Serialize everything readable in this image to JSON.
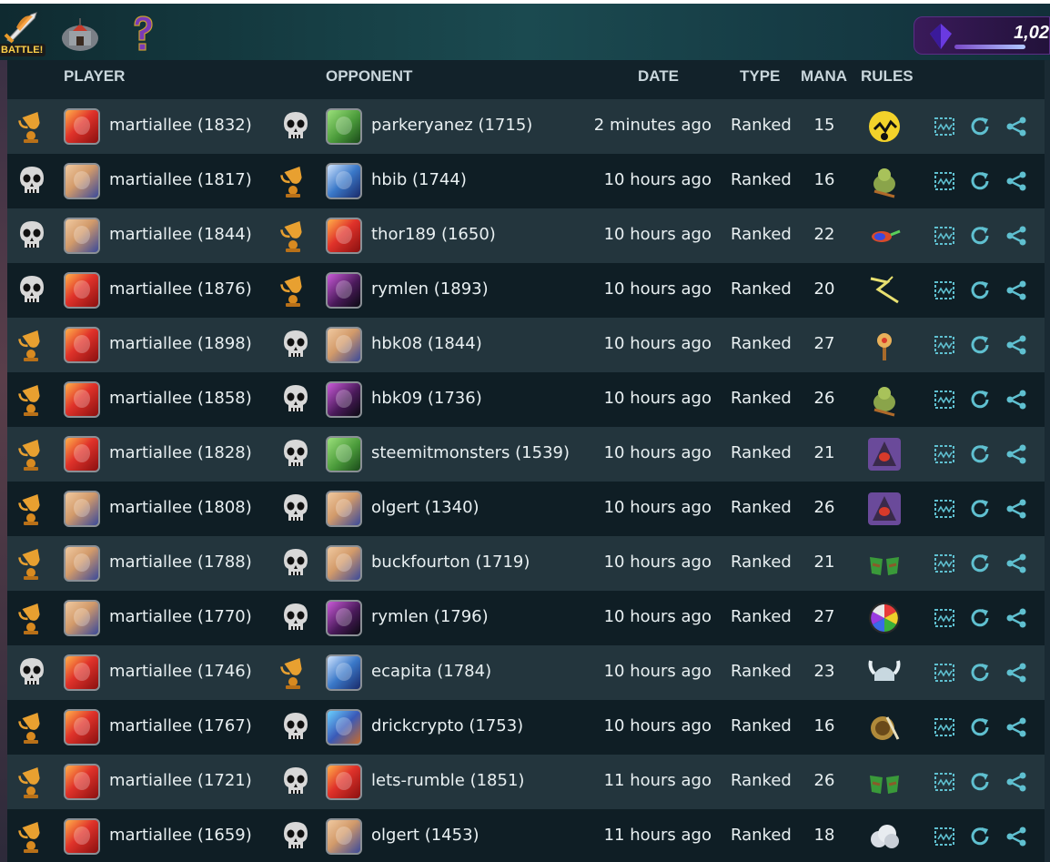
{
  "nav": {
    "battle_label": "BATTLE!",
    "dec_value": "1,02"
  },
  "headers": {
    "player": "PLAYER",
    "opponent": "OPPONENT",
    "date": "DATE",
    "type": "TYPE",
    "mana": "MANA",
    "rules": "RULES"
  },
  "colors": {
    "trophy": "#e8a030",
    "skull": "#d8d8d8",
    "action": "#5fc0d0"
  },
  "battles": [
    {
      "player_result": "win",
      "player_avatar": "fire",
      "player": "martiallee (1832)",
      "opp_result": "loss",
      "opp_avatar": "green",
      "opponent": "parkeryanez (1715)",
      "date": "2 minutes ago",
      "type": "Ranked",
      "mana": "15",
      "rule_icon": "earthquake-yellow-icon"
    },
    {
      "player_result": "loss",
      "player_avatar": "hero",
      "player": "martiallee (1817)",
      "opp_result": "win",
      "opp_avatar": "wizard",
      "opponent": "hbib (1744)",
      "date": "10 hours ago",
      "type": "Ranked",
      "mana": "16",
      "rule_icon": "goblin-icon"
    },
    {
      "player_result": "loss",
      "player_avatar": "hero",
      "player": "martiallee (1844)",
      "opp_result": "win",
      "opp_avatar": "fire",
      "opponent": "thor189 (1650)",
      "date": "10 hours ago",
      "type": "Ranked",
      "mana": "22",
      "rule_icon": "comet-icon"
    },
    {
      "player_result": "loss",
      "player_avatar": "fire",
      "player": "martiallee (1876)",
      "opp_result": "win",
      "opp_avatar": "dark",
      "opponent": "rymlen (1893)",
      "date": "10 hours ago",
      "type": "Ranked",
      "mana": "20",
      "rule_icon": "lightning-icon"
    },
    {
      "player_result": "win",
      "player_avatar": "fire",
      "player": "martiallee (1898)",
      "opp_result": "loss",
      "opp_avatar": "hero",
      "opponent": "hbk08 (1844)",
      "date": "10 hours ago",
      "type": "Ranked",
      "mana": "27",
      "rule_icon": "target-dummy-icon"
    },
    {
      "player_result": "win",
      "player_avatar": "fire",
      "player": "martiallee (1858)",
      "opp_result": "loss",
      "opp_avatar": "dark",
      "opponent": "hbk09 (1736)",
      "date": "10 hours ago",
      "type": "Ranked",
      "mana": "26",
      "rule_icon": "goblin-icon"
    },
    {
      "player_result": "win",
      "player_avatar": "fire",
      "player": "martiallee (1828)",
      "opp_result": "loss",
      "opp_avatar": "green",
      "opponent": "steemitmonsters (1539)",
      "date": "10 hours ago",
      "type": "Ranked",
      "mana": "21",
      "rule_icon": "hooded-figure-icon"
    },
    {
      "player_result": "win",
      "player_avatar": "hero",
      "player": "martiallee (1808)",
      "opp_result": "loss",
      "opp_avatar": "hero",
      "opponent": "olgert (1340)",
      "date": "10 hours ago",
      "type": "Ranked",
      "mana": "26",
      "rule_icon": "hooded-figure-icon"
    },
    {
      "player_result": "win",
      "player_avatar": "hero",
      "player": "martiallee (1788)",
      "opp_result": "loss",
      "opp_avatar": "hero",
      "opponent": "buckfourton (1719)",
      "date": "10 hours ago",
      "type": "Ranked",
      "mana": "21",
      "rule_icon": "broken-bridge-icon"
    },
    {
      "player_result": "win",
      "player_avatar": "hero",
      "player": "martiallee (1770)",
      "opp_result": "loss",
      "opp_avatar": "dark",
      "opponent": "rymlen (1796)",
      "date": "10 hours ago",
      "type": "Ranked",
      "mana": "27",
      "rule_icon": "color-wheel-icon"
    },
    {
      "player_result": "loss",
      "player_avatar": "fire",
      "player": "martiallee (1746)",
      "opp_result": "win",
      "opp_avatar": "wizard",
      "opponent": "ecapita (1784)",
      "date": "10 hours ago",
      "type": "Ranked",
      "mana": "23",
      "rule_icon": "viking-helmet-icon"
    },
    {
      "player_result": "win",
      "player_avatar": "fire",
      "player": "martiallee (1767)",
      "opp_result": "loss",
      "opp_avatar": "dragon",
      "opponent": "drickcrypto (1753)",
      "date": "10 hours ago",
      "type": "Ranked",
      "mana": "16",
      "rule_icon": "shield-swords-icon"
    },
    {
      "player_result": "win",
      "player_avatar": "fire",
      "player": "martiallee (1721)",
      "opp_result": "loss",
      "opp_avatar": "fire",
      "opponent": "lets-rumble (1851)",
      "date": "11 hours ago",
      "type": "Ranked",
      "mana": "26",
      "rule_icon": "broken-bridge-icon"
    },
    {
      "player_result": "win",
      "player_avatar": "fire",
      "player": "martiallee (1659)",
      "opp_result": "loss",
      "opp_avatar": "hero",
      "opponent": "olgert (1453)",
      "date": "11 hours ago",
      "type": "Ranked",
      "mana": "18",
      "rule_icon": "cloud-icon"
    }
  ]
}
